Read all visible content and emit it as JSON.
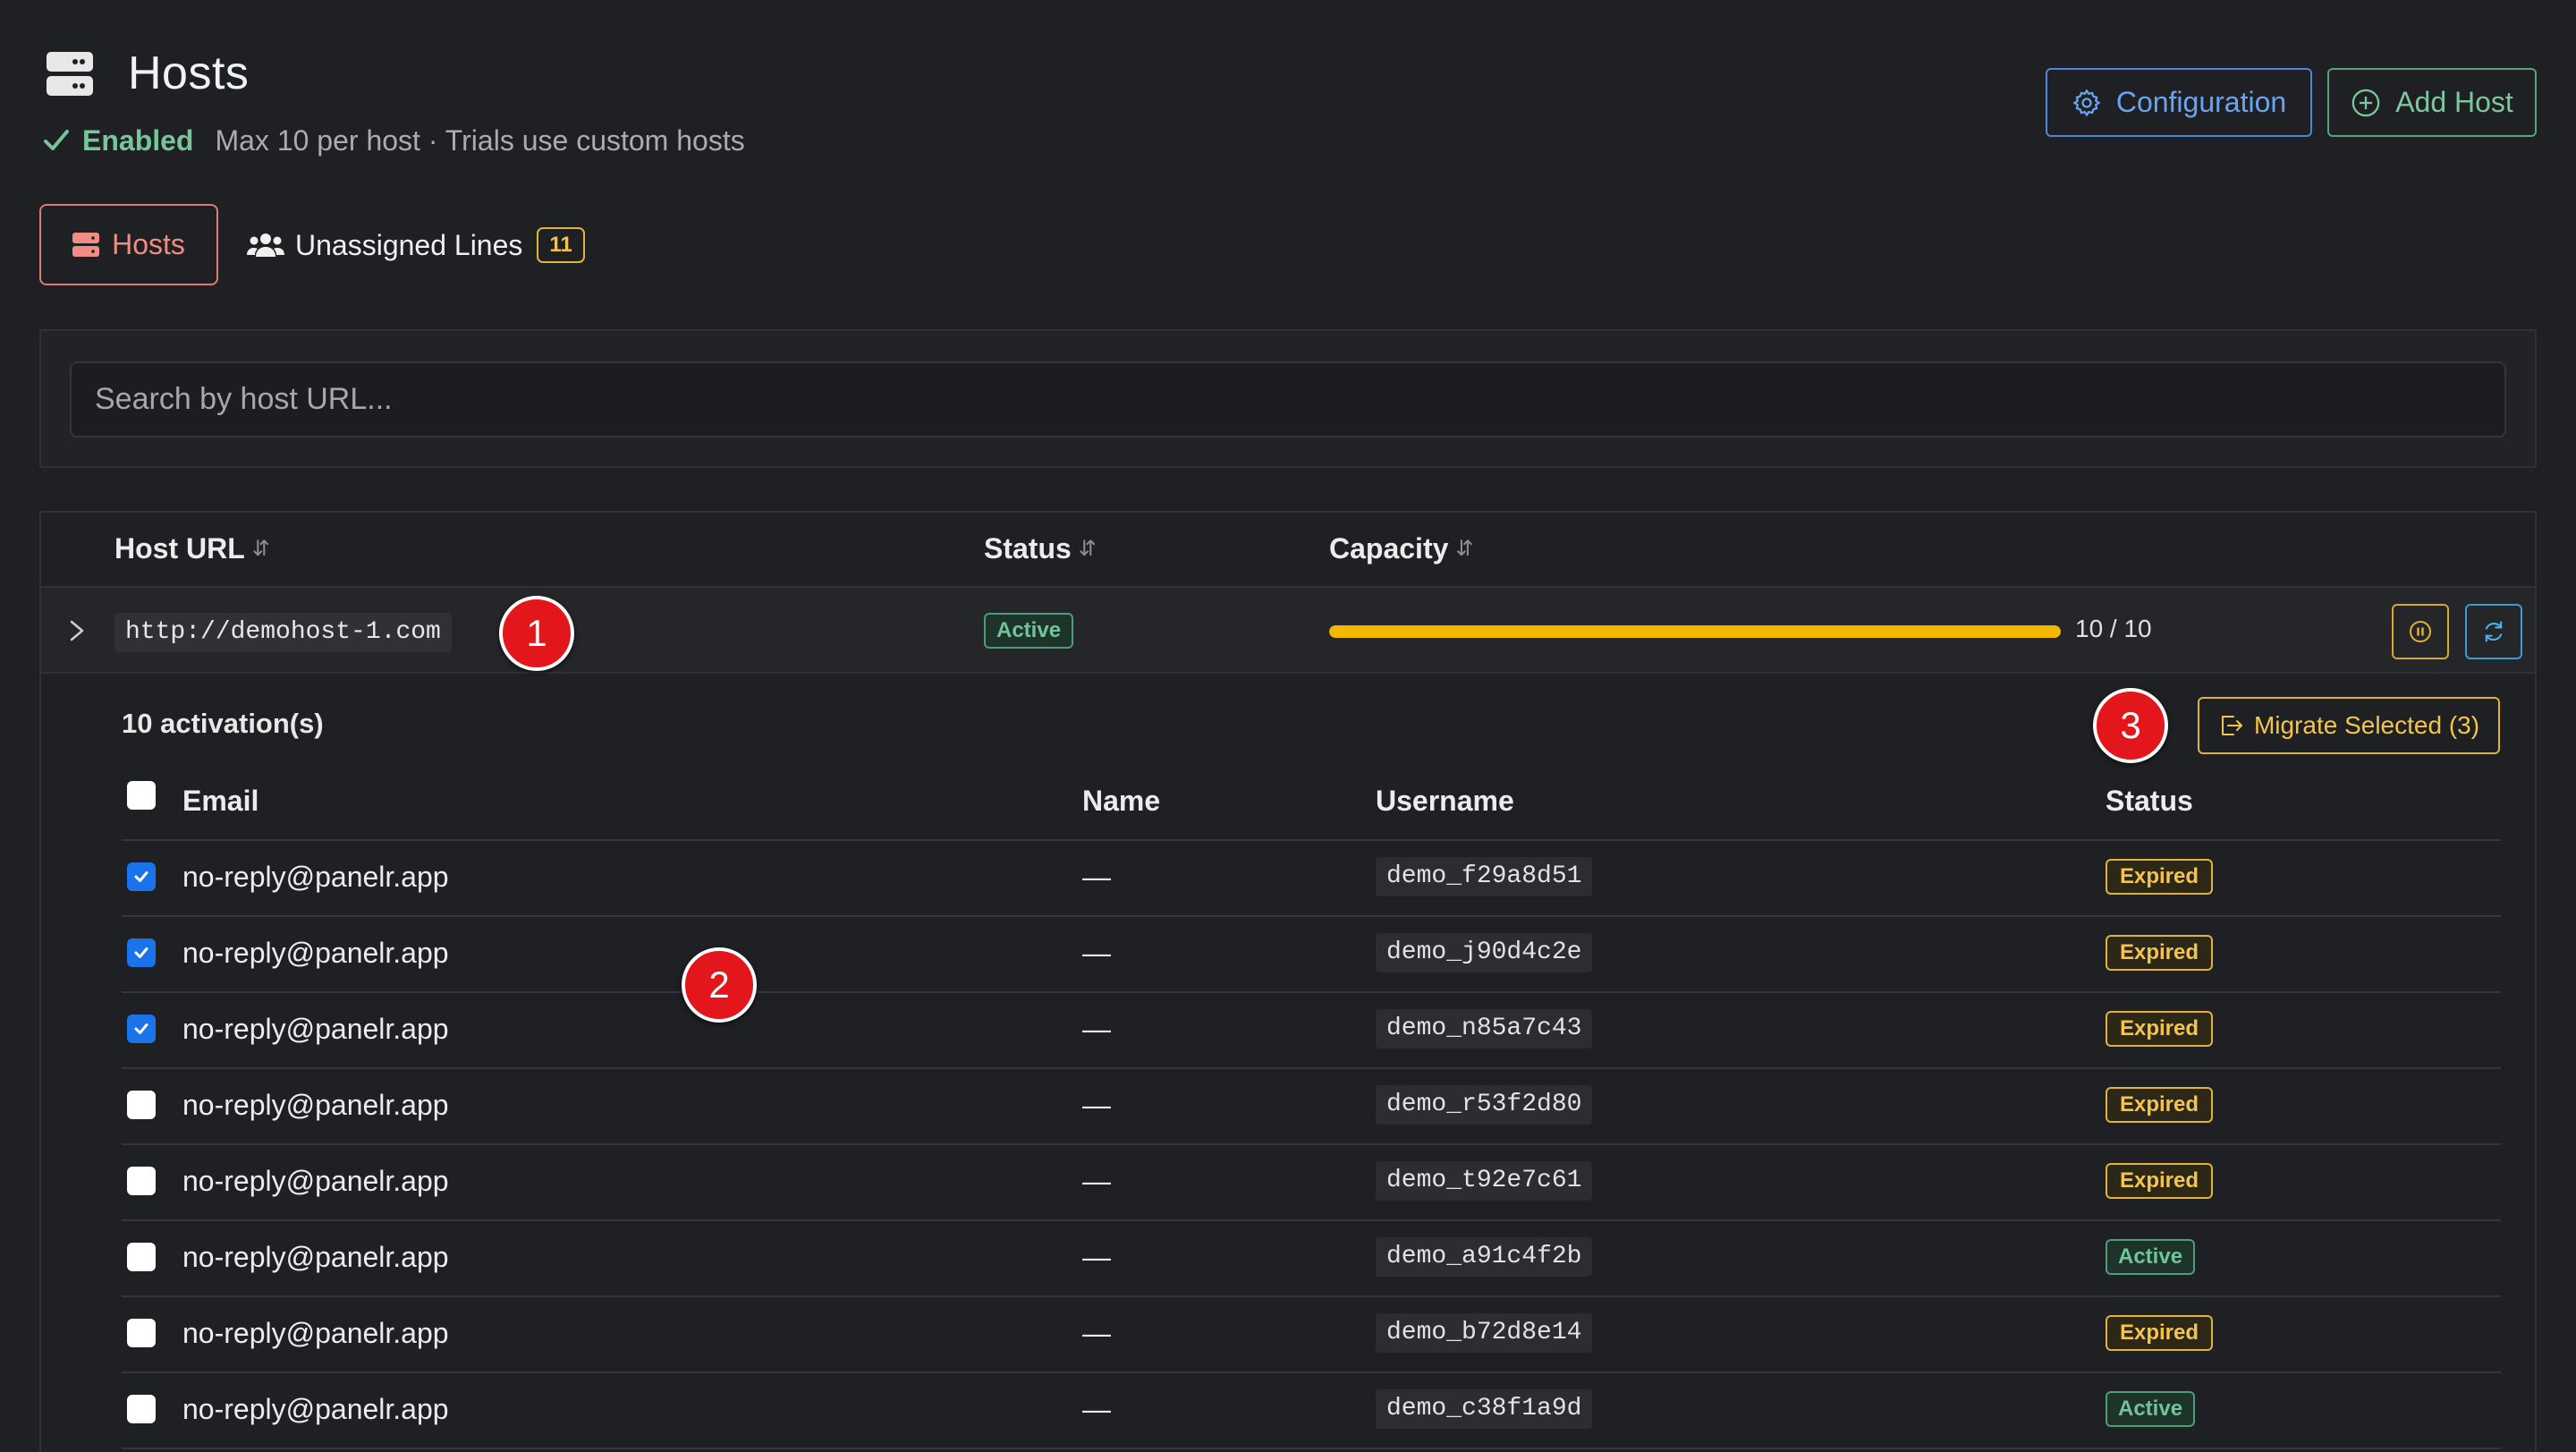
{
  "header": {
    "title": "Hosts",
    "enabled_label": "Enabled",
    "meta": "Max 10 per host · Trials use custom hosts",
    "config_button": "Configuration",
    "add_button": "Add Host"
  },
  "tabs": {
    "hosts": "Hosts",
    "unassigned": "Unassigned Lines",
    "unassigned_count": "11"
  },
  "search": {
    "placeholder": "Search by host URL..."
  },
  "table": {
    "columns": {
      "host_url": "Host URL",
      "status": "Status",
      "capacity": "Capacity"
    },
    "host": {
      "url": "http://demohost-1.com",
      "status": "Active",
      "capacity_text": "10 / 10",
      "capacity_fraction": 1.0
    }
  },
  "activations": {
    "count_label": "10 activation(s)",
    "migrate_button": "Migrate Selected (3)",
    "columns": {
      "email": "Email",
      "name": "Name",
      "username": "Username",
      "status": "Status"
    },
    "rows": [
      {
        "checked": true,
        "email": "no-reply@panelr.app",
        "name": "—",
        "username": "demo_f29a8d51",
        "status": "Expired"
      },
      {
        "checked": true,
        "email": "no-reply@panelr.app",
        "name": "—",
        "username": "demo_j90d4c2e",
        "status": "Expired"
      },
      {
        "checked": true,
        "email": "no-reply@panelr.app",
        "name": "—",
        "username": "demo_n85a7c43",
        "status": "Expired"
      },
      {
        "checked": false,
        "email": "no-reply@panelr.app",
        "name": "—",
        "username": "demo_r53f2d80",
        "status": "Expired"
      },
      {
        "checked": false,
        "email": "no-reply@panelr.app",
        "name": "—",
        "username": "demo_t92e7c61",
        "status": "Expired"
      },
      {
        "checked": false,
        "email": "no-reply@panelr.app",
        "name": "—",
        "username": "demo_a91c4f2b",
        "status": "Active"
      },
      {
        "checked": false,
        "email": "no-reply@panelr.app",
        "name": "—",
        "username": "demo_b72d8e14",
        "status": "Expired"
      },
      {
        "checked": false,
        "email": "no-reply@panelr.app",
        "name": "—",
        "username": "demo_c38f1a9d",
        "status": "Active"
      }
    ]
  },
  "markers": [
    "1",
    "2",
    "3"
  ],
  "colors": {
    "background": "#1f2023",
    "accent_red": "#e07a72",
    "accent_blue": "#4f86d6",
    "accent_green": "#5aa27c",
    "warning_yellow": "#e2b33c",
    "capacity_fill": "#f5b800",
    "checkbox_blue": "#1a73e8"
  }
}
